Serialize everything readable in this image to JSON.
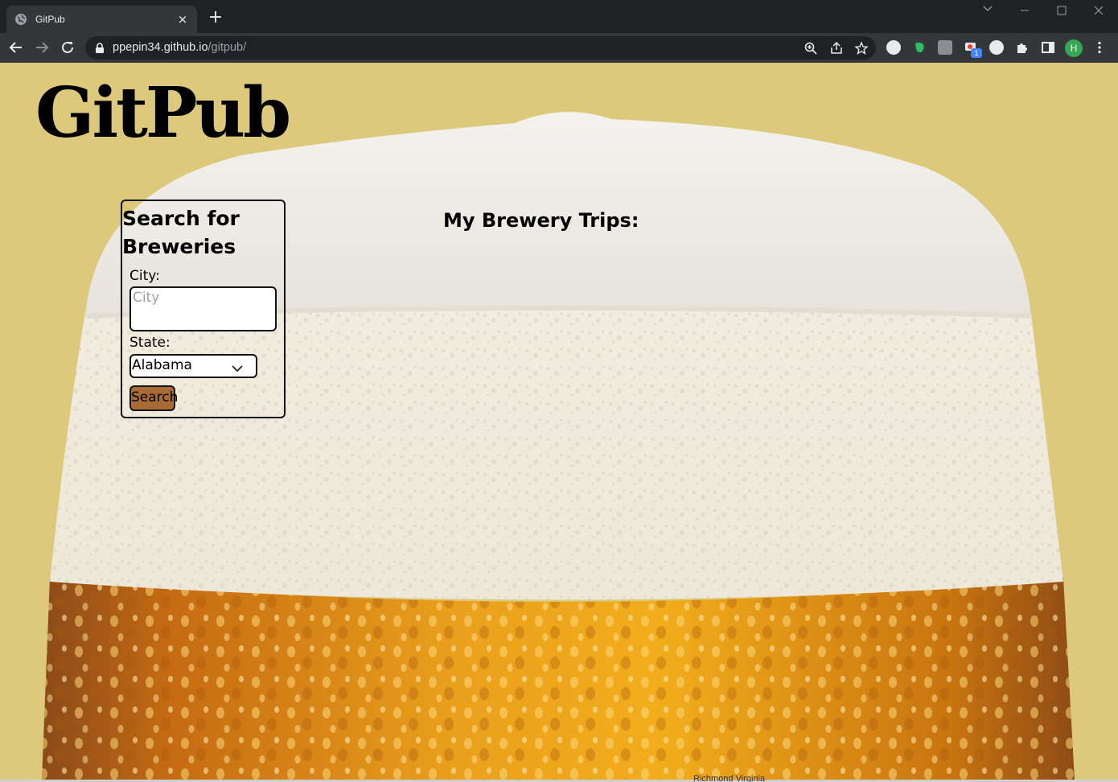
{
  "browser": {
    "tab_title": "GitPub",
    "tab_close": "×",
    "new_tab": "+",
    "url_host": "ppepin34.github.io",
    "url_path": "/gitpub/",
    "profile_initial": "H",
    "extension_badge": "1"
  },
  "page": {
    "site_title": "GitPub",
    "search": {
      "heading": "Search for Breweries",
      "city_label": "City:",
      "city_placeholder": "City",
      "city_value": "",
      "state_label": "State:",
      "state_selected": "Alabama",
      "button_label": "Search"
    },
    "trips_heading": "My Brewery Trips:",
    "peek_text": "Richmond Virginia"
  },
  "colors": {
    "page_background": "#dcc97c",
    "search_button": "#a86b35",
    "chrome_dark": "#202124",
    "chrome_toolbar": "#35363a"
  },
  "icons": [
    "globe-icon",
    "close-icon",
    "plus-icon",
    "back-icon",
    "forward-icon",
    "reload-icon",
    "lock-icon",
    "zoom-icon",
    "share-icon",
    "star-icon",
    "extension-icon",
    "puzzle-icon",
    "sidepanel-icon",
    "menu-icon",
    "chevron-down-icon"
  ]
}
